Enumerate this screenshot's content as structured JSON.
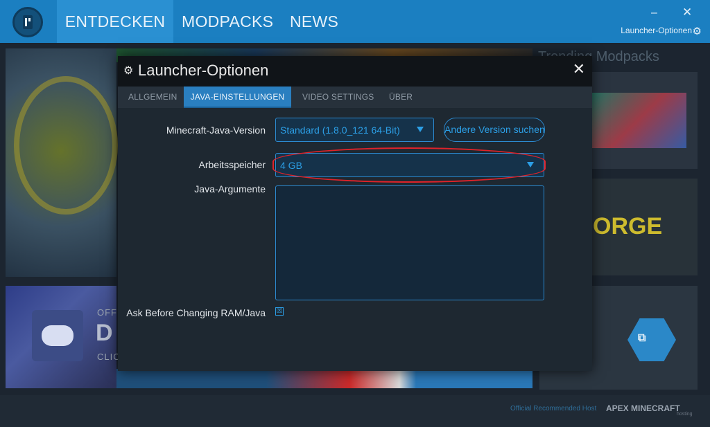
{
  "nav": {
    "tabs": [
      "ENTDECKEN",
      "MODPACKS",
      "NEWS"
    ],
    "minimize": "–",
    "close": "✕",
    "options_link": "Launcher-Optionen"
  },
  "background": {
    "trending_title": "Trending Modpacks",
    "forge_text": "ORGE",
    "discord_line1": "OFFI",
    "discord_big": "D",
    "discord_line2": "CLIC",
    "footer_host": "Official Recommended Host",
    "footer_brand": "APEX MINECRAFT",
    "footer_brand_sub": "hosting"
  },
  "modal": {
    "title": "Launcher-Optionen",
    "close": "✕",
    "tabs": [
      "ALLGEMEIN",
      "JAVA-EINSTELLUNGEN",
      "VIDEO SETTINGS",
      "ÜBER"
    ],
    "active_tab": "JAVA-EINSTELLUNGEN",
    "java_version_label": "Minecraft-Java-Version",
    "java_version_value": "Standard (1.8.0_121 64-Bit)",
    "other_version_button": "Andere Version suchen",
    "memory_label": "Arbeitsspeicher",
    "memory_value": "4 GB",
    "java_args_label": "Java-Argumente",
    "java_args_value": "",
    "ask_label": "Ask Before Changing RAM/Java",
    "ask_checked": true,
    "check_glyph": "☒"
  },
  "colors": {
    "topbar": "#1b7fc1",
    "accent": "#2c9fe6",
    "highlight_ring": "#e0232a"
  }
}
